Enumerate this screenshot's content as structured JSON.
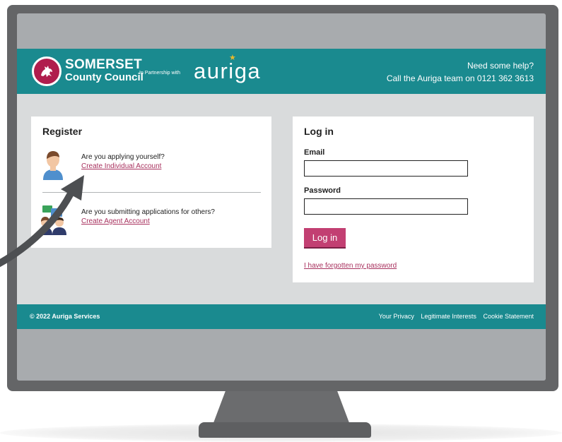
{
  "header": {
    "brand_top": "SOMERSET",
    "brand_bottom": "County Council",
    "partnership": "In Partnership with",
    "partner_name": "auriga",
    "help_title": "Need some help?",
    "help_phone": "Call the Auriga team on 0121 362 3613"
  },
  "register": {
    "title": "Register",
    "individual_question": "Are you applying yourself?",
    "individual_link": "Create Individual Account",
    "agent_question": "Are you submitting applications for others?",
    "agent_link": "Create Agent Account"
  },
  "login": {
    "title": "Log in",
    "email_label": "Email",
    "email_value": "",
    "password_label": "Password",
    "password_value": "",
    "button_label": "Log in",
    "forgot_link": "I have forgotten my password"
  },
  "footer": {
    "copyright": "© 2022 Auriga Services",
    "links": [
      "Your Privacy",
      "Legitimate Interests",
      "Cookie Statement"
    ]
  },
  "colors": {
    "teal": "#1a8a8f",
    "accent": "#c23f72",
    "brand_red": "#b01d4d",
    "star": "#e7b92c"
  },
  "icons": [
    "somerset-crest-icon",
    "individual-person-icon",
    "agent-group-icon",
    "pointer-arrow-icon"
  ]
}
